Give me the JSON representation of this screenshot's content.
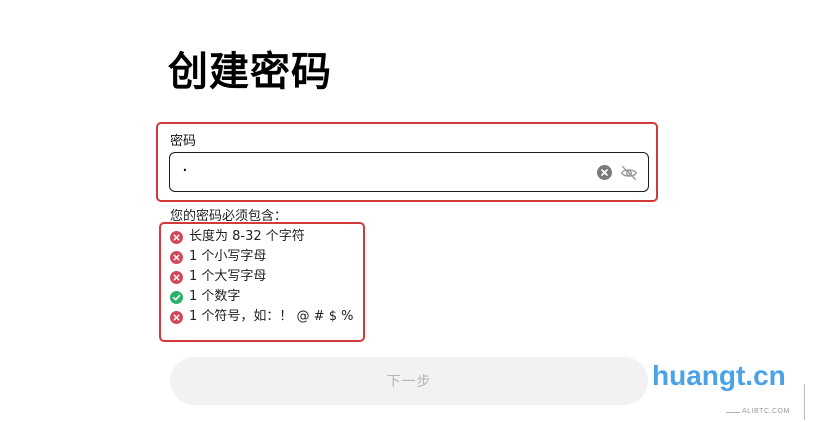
{
  "page": {
    "title": "创建密码"
  },
  "password": {
    "label": "密码",
    "value": "·",
    "clear_icon": "clear-circle-icon",
    "visibility_icon": "eye-off-icon"
  },
  "requirements": {
    "heading": "您的密码必须包含：",
    "items": [
      {
        "text": "长度为 8-32 个字符",
        "status": "unmet"
      },
      {
        "text": "1 个小写字母",
        "status": "unmet"
      },
      {
        "text": "1 个大写字母",
        "status": "unmet"
      },
      {
        "text": "1 个数字",
        "status": "met"
      },
      {
        "text": "1 个符号，如：！ @ # $ %",
        "status": "unmet"
      }
    ]
  },
  "actions": {
    "next_label": "下一步"
  },
  "watermark": {
    "text": "huangt.cn",
    "sub": "ALIBTC.COM"
  },
  "colors": {
    "unmet": "#d0485a",
    "met": "#2cb16a",
    "highlight_border": "#d23a3a",
    "button_bg": "#f2f2f2",
    "button_text": "#b5b5b5",
    "watermark": "#4aa3e8"
  }
}
